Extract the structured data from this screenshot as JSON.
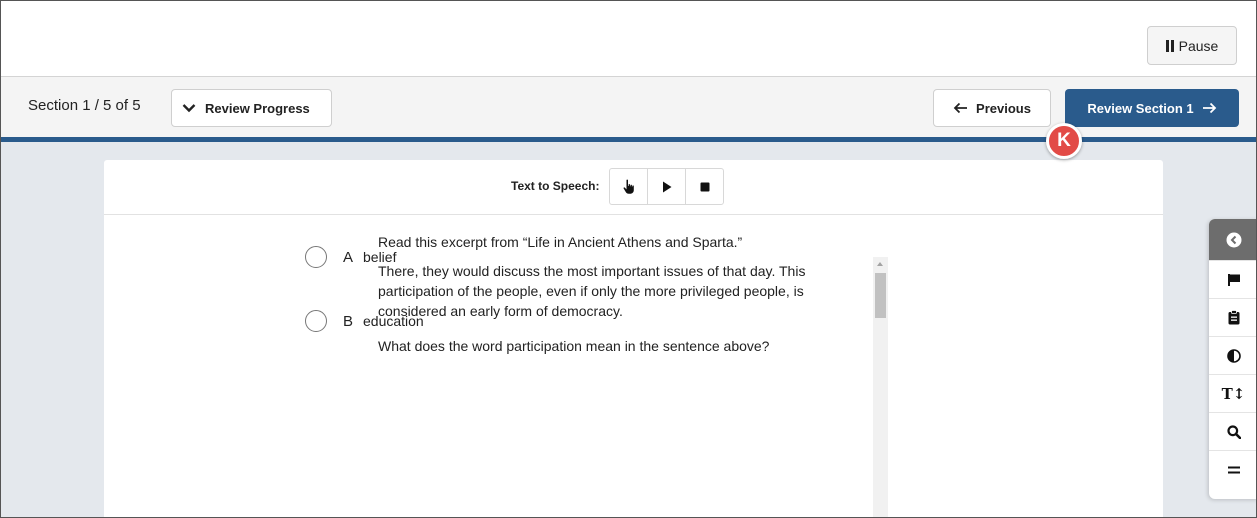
{
  "toolbar": {
    "pause_label": "Pause"
  },
  "nav": {
    "section_prefix": "Section ",
    "section_current": "1 / 5",
    "section_suffix": " of 5",
    "review_progress_label": "Review Progress",
    "previous_label": "Previous",
    "next_label": "Review Section 1"
  },
  "badge": {
    "letter": "K"
  },
  "tts": {
    "label": "Text to Speech:"
  },
  "question": {
    "intro": "Read this excerpt from “Life in Ancient Athens and Sparta.”",
    "excerpt": "There, they would discuss the most important issues of that day. This participation of the people, even if only the more privileged people, is considered an early form of democracy.",
    "stem": "What does the word participation mean in the sentence above?",
    "options": [
      {
        "letter": "A",
        "text": "belief"
      },
      {
        "letter": "B",
        "text": "education"
      }
    ]
  },
  "tools": {
    "text_size_label": "T↕"
  },
  "colors": {
    "primary": "#2a5b8c",
    "badge": "#e24b47",
    "content_bg": "#e4e8ed"
  }
}
